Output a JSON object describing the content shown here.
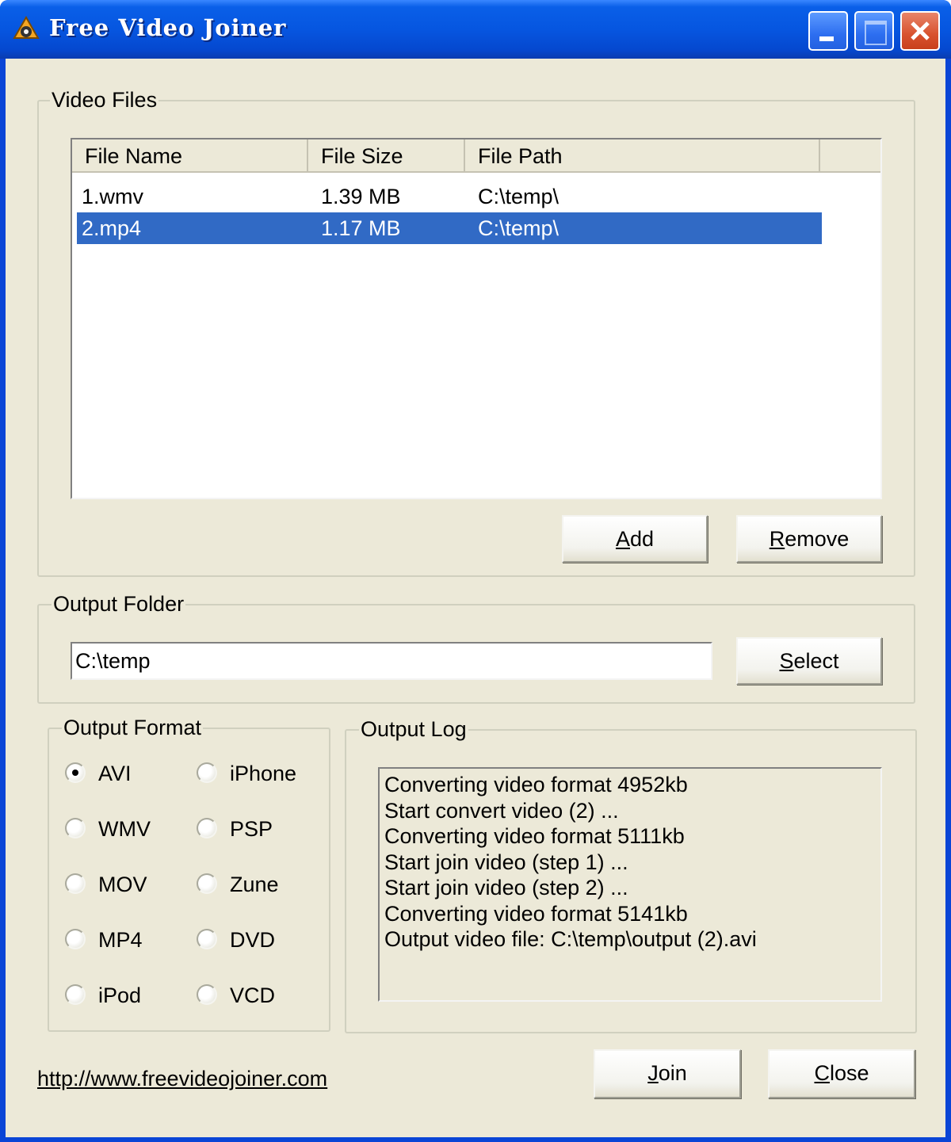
{
  "window": {
    "title": "Free Video Joiner",
    "titlebar_color": "#0a5fe8",
    "close_color": "#d8522e"
  },
  "video_files": {
    "group_label": "Video Files",
    "columns": [
      "File Name",
      "File Size",
      "File Path"
    ],
    "rows": [
      {
        "name": "1.wmv",
        "size": "1.39 MB",
        "path": "C:\\temp\\",
        "selected": false
      },
      {
        "name": "2.mp4",
        "size": "1.17 MB",
        "path": "C:\\temp\\",
        "selected": true
      }
    ],
    "selection_color": "#316ac5",
    "add_label_mnemonic": "A",
    "add_label_rest": "dd",
    "remove_label_mnemonic": "R",
    "remove_label_rest": "emove"
  },
  "output_folder": {
    "group_label": "Output Folder",
    "value": "C:\\temp",
    "select_label_mnemonic": "S",
    "select_label_rest": "elect"
  },
  "output_format": {
    "group_label": "Output Format",
    "options_left": [
      "AVI",
      "WMV",
      "MOV",
      "MP4",
      "iPod"
    ],
    "options_right": [
      "iPhone",
      "PSP",
      "Zune",
      "DVD",
      "VCD"
    ],
    "selected": "AVI"
  },
  "output_log": {
    "group_label": "Output Log",
    "lines": [
      "Converting video format 4952kb",
      "Start convert video (2) ...",
      "Converting video format 5111kb",
      "Start join video (step 1) ...",
      "Start join video (step 2) ...",
      "Converting video format 5141kb",
      "Output video file: C:\\temp\\output (2).avi"
    ]
  },
  "footer": {
    "link": "http://www.freevideojoiner.com",
    "join_label_mnemonic": "J",
    "join_label_rest": "oin",
    "close_label_mnemonic": "C",
    "close_label_rest": "lose"
  }
}
